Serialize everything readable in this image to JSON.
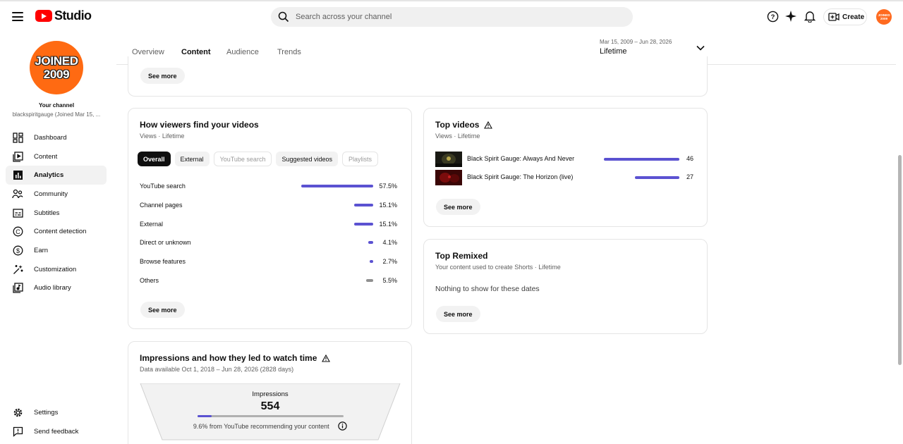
{
  "app": {
    "logo_text": "Studio",
    "search_placeholder": "Search across your channel",
    "create_label": "Create",
    "avatar_text": "JOINED 2009"
  },
  "channel": {
    "avatar_line1": "JOINED",
    "avatar_line2": "2009",
    "title": "Your channel",
    "subtitle": "blackspiritgauge (Joined Mar 15, ..."
  },
  "nav": {
    "items": [
      {
        "label": "Dashboard",
        "icon": "dashboard-icon"
      },
      {
        "label": "Content",
        "icon": "content-icon"
      },
      {
        "label": "Analytics",
        "icon": "analytics-icon",
        "active": true
      },
      {
        "label": "Community",
        "icon": "community-icon"
      },
      {
        "label": "Subtitles",
        "icon": "subtitles-icon"
      },
      {
        "label": "Content detection",
        "icon": "content-detection-icon"
      },
      {
        "label": "Earn",
        "icon": "earn-icon"
      },
      {
        "label": "Customization",
        "icon": "customization-icon"
      },
      {
        "label": "Audio library",
        "icon": "audio-library-icon"
      }
    ],
    "bottom": [
      {
        "label": "Settings",
        "icon": "gear-icon"
      },
      {
        "label": "Send feedback",
        "icon": "feedback-icon"
      }
    ]
  },
  "tabs": [
    {
      "label": "Overview"
    },
    {
      "label": "Content",
      "active": true
    },
    {
      "label": "Audience"
    },
    {
      "label": "Trends"
    }
  ],
  "date_range": {
    "range": "Mar 15, 2009 – Jun 28, 2026",
    "label": "Lifetime"
  },
  "top_card": {
    "see_more": "See more"
  },
  "traffic": {
    "title": "How viewers find your videos",
    "subtitle": "Views · Lifetime",
    "chips": [
      {
        "label": "Overall",
        "state": "active"
      },
      {
        "label": "External",
        "state": "normal"
      },
      {
        "label": "YouTube search",
        "state": "disabled"
      },
      {
        "label": "Suggested videos",
        "state": "normal"
      },
      {
        "label": "Playlists",
        "state": "disabled"
      }
    ],
    "sources": [
      {
        "label": "YouTube search",
        "value": "57.5%",
        "share": 57.5
      },
      {
        "label": "Channel pages",
        "value": "15.1%",
        "share": 15.1
      },
      {
        "label": "External",
        "value": "15.1%",
        "share": 15.1
      },
      {
        "label": "Direct or unknown",
        "value": "4.1%",
        "share": 4.1
      },
      {
        "label": "Browse features",
        "value": "2.7%",
        "share": 2.7
      },
      {
        "label": "Others",
        "value": "5.5%",
        "share": 5.5,
        "grey": true
      }
    ],
    "see_more": "See more"
  },
  "top_videos": {
    "title": "Top videos",
    "subtitle": "Views · Lifetime",
    "videos": [
      {
        "title": "Black Spirit Gauge: Always And Never",
        "value": "46",
        "views": 46
      },
      {
        "title": "Black Spirit Gauge: The Horizon (live)",
        "value": "27",
        "views": 27
      }
    ],
    "see_more": "See more"
  },
  "top_remixed": {
    "title": "Top Remixed",
    "subtitle": "Your content used to create Shorts · Lifetime",
    "empty": "Nothing to show for these dates",
    "see_more": "See more"
  },
  "impressions": {
    "title": "Impressions and how they led to watch time",
    "subtitle": "Data available Oct 1, 2018 – Jun 28, 2026 (2828 days)",
    "label": "Impressions",
    "value": "554",
    "note": "9.6% from YouTube recommending your content",
    "recommend_share": 9.6
  },
  "colors": {
    "accent": "#5b52d1",
    "brand": "#ff0000",
    "avatar": "#ff6a12"
  }
}
